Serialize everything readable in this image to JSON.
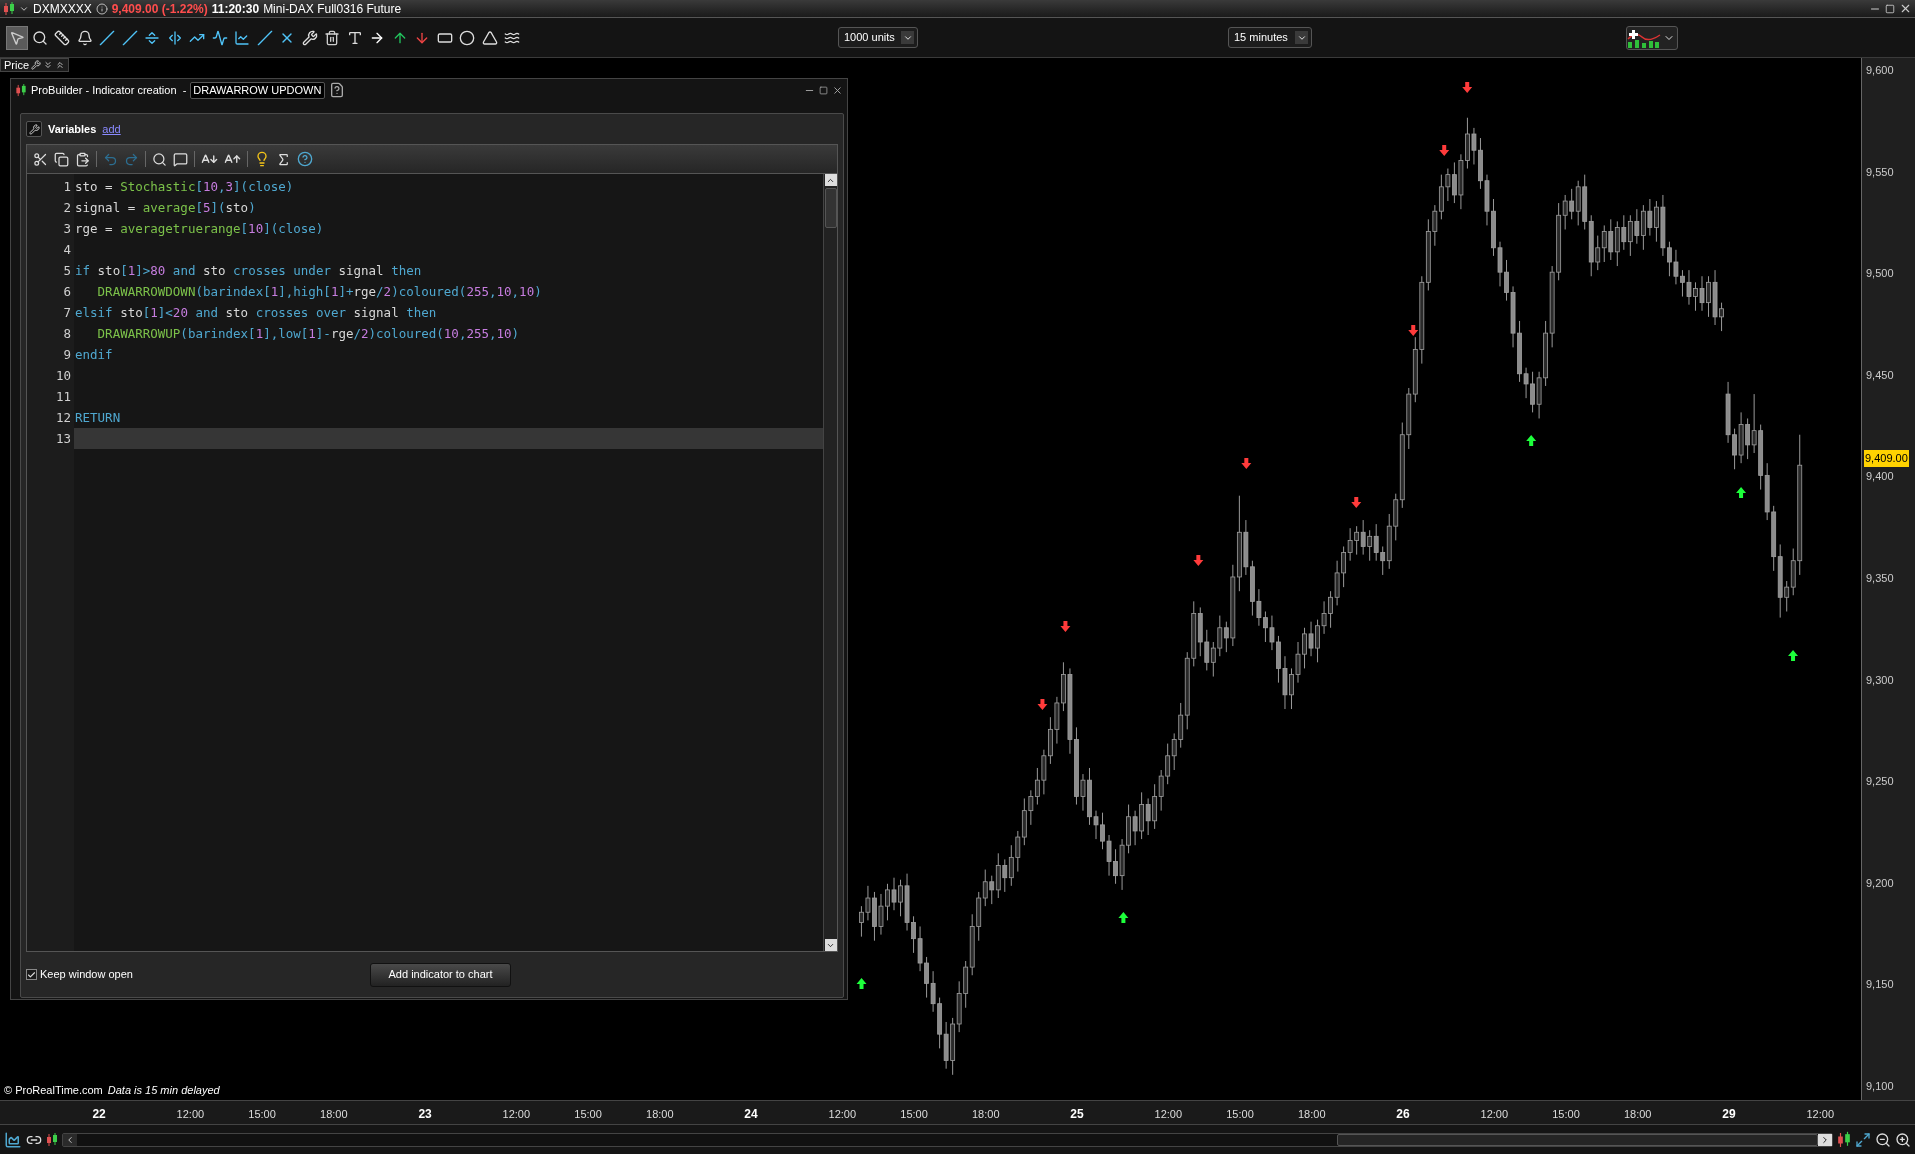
{
  "title_bar": {
    "symbol": "DXMXXXX",
    "price": "9,409.00 (-1.22%)",
    "time": "11:20:30",
    "instrument": "Mini-DAX Full0316 Future"
  },
  "toolbar": {
    "tools": [
      {
        "kind": "pointer",
        "selected": true
      },
      {
        "kind": "zoom",
        "selected": false
      },
      {
        "kind": "ruler",
        "selected": false
      },
      {
        "kind": "alert",
        "selected": false
      },
      {
        "kind": "segment",
        "selected": false
      },
      {
        "kind": "ray",
        "selected": false
      },
      {
        "kind": "hline",
        "selected": false
      },
      {
        "kind": "vline",
        "selected": false
      },
      {
        "kind": "channel",
        "selected": false
      },
      {
        "kind": "trend",
        "selected": false
      },
      {
        "kind": "regression",
        "selected": false
      },
      {
        "kind": "diagonal",
        "selected": false
      },
      {
        "kind": "cross",
        "selected": false
      },
      {
        "kind": "tools",
        "selected": false
      },
      {
        "kind": "trash",
        "selected": false
      },
      {
        "kind": "text",
        "selected": false
      },
      {
        "kind": "arrow-right",
        "selected": false
      },
      {
        "kind": "arrow-up",
        "selected": false
      },
      {
        "kind": "arrow-down",
        "selected": false
      },
      {
        "kind": "rectangle",
        "selected": false
      },
      {
        "kind": "ellipse",
        "selected": false
      },
      {
        "kind": "triangle",
        "selected": false
      },
      {
        "kind": "fan",
        "selected": false
      }
    ],
    "units": "1000 units",
    "timeframe": "15 minutes"
  },
  "price_panel": {
    "label": "Price"
  },
  "editor": {
    "title": "ProBuilder - Indicator creation  -",
    "name_value": "DRAWARROW UPDOWN",
    "variables_label": "Variables",
    "add_link": "add",
    "lines": [
      {
        "number": "1",
        "current": false,
        "tokens": [
          {
            "kind": "plain",
            "t": "sto = "
          },
          {
            "kind": "func",
            "t": "Stochastic"
          },
          {
            "kind": "kw",
            "t": "["
          },
          {
            "kind": "num",
            "t": "10"
          },
          {
            "kind": "kw",
            "t": ","
          },
          {
            "kind": "num",
            "t": "3"
          },
          {
            "kind": "kw",
            "t": "](close)"
          }
        ]
      },
      {
        "number": "2",
        "current": false,
        "tokens": [
          {
            "kind": "plain",
            "t": "signal = "
          },
          {
            "kind": "func",
            "t": "average"
          },
          {
            "kind": "kw",
            "t": "["
          },
          {
            "kind": "num",
            "t": "5"
          },
          {
            "kind": "kw",
            "t": "]("
          },
          {
            "kind": "plain",
            "t": "sto"
          },
          {
            "kind": "kw",
            "t": ")"
          }
        ]
      },
      {
        "number": "3",
        "current": false,
        "tokens": [
          {
            "kind": "plain",
            "t": "rge = "
          },
          {
            "kind": "func",
            "t": "averagetruerange"
          },
          {
            "kind": "kw",
            "t": "["
          },
          {
            "kind": "num",
            "t": "10"
          },
          {
            "kind": "kw",
            "t": "](close)"
          }
        ]
      },
      {
        "number": "4",
        "current": false
      },
      {
        "number": "5",
        "current": false,
        "tokens": [
          {
            "kind": "kw",
            "t": "if "
          },
          {
            "kind": "plain",
            "t": "sto"
          },
          {
            "kind": "kw",
            "t": "["
          },
          {
            "kind": "num",
            "t": "1"
          },
          {
            "kind": "kw",
            "t": "]>"
          },
          {
            "kind": "num",
            "t": "80"
          },
          {
            "kind": "kw",
            "t": " and "
          },
          {
            "kind": "plain",
            "t": "sto "
          },
          {
            "kind": "kw",
            "t": "crosses under "
          },
          {
            "kind": "plain",
            "t": "signal "
          },
          {
            "kind": "kw",
            "t": "then"
          }
        ]
      },
      {
        "number": "6",
        "current": false,
        "tokens": [
          {
            "kind": "func",
            "t": "   DRAWARROWDOWN"
          },
          {
            "kind": "kw",
            "t": "(barindex["
          },
          {
            "kind": "num",
            "t": "1"
          },
          {
            "kind": "kw",
            "t": "],high["
          },
          {
            "kind": "num",
            "t": "1"
          },
          {
            "kind": "kw",
            "t": "]+"
          },
          {
            "kind": "plain",
            "t": "rge"
          },
          {
            "kind": "kw",
            "t": "/"
          },
          {
            "kind": "num",
            "t": "2"
          },
          {
            "kind": "kw",
            "t": ")coloured("
          },
          {
            "kind": "num",
            "t": "255"
          },
          {
            "kind": "kw",
            "t": ","
          },
          {
            "kind": "num",
            "t": "10"
          },
          {
            "kind": "kw",
            "t": ","
          },
          {
            "kind": "num",
            "t": "10"
          },
          {
            "kind": "kw",
            "t": ")"
          }
        ]
      },
      {
        "number": "7",
        "current": false,
        "tokens": [
          {
            "kind": "kw",
            "t": "elsif "
          },
          {
            "kind": "plain",
            "t": "sto"
          },
          {
            "kind": "kw",
            "t": "["
          },
          {
            "kind": "num",
            "t": "1"
          },
          {
            "kind": "kw",
            "t": "]<"
          },
          {
            "kind": "num",
            "t": "20"
          },
          {
            "kind": "kw",
            "t": " and "
          },
          {
            "kind": "plain",
            "t": "sto "
          },
          {
            "kind": "kw",
            "t": "crosses over "
          },
          {
            "kind": "plain",
            "t": "signal "
          },
          {
            "kind": "kw",
            "t": "then"
          }
        ]
      },
      {
        "number": "8",
        "current": false,
        "tokens": [
          {
            "kind": "func",
            "t": "   DRAWARROWUP"
          },
          {
            "kind": "kw",
            "t": "(barindex["
          },
          {
            "kind": "num",
            "t": "1"
          },
          {
            "kind": "kw",
            "t": "],low["
          },
          {
            "kind": "num",
            "t": "1"
          },
          {
            "kind": "kw",
            "t": "]-"
          },
          {
            "kind": "plain",
            "t": "rge"
          },
          {
            "kind": "kw",
            "t": "/"
          },
          {
            "kind": "num",
            "t": "2"
          },
          {
            "kind": "kw",
            "t": ")coloured("
          },
          {
            "kind": "num",
            "t": "10"
          },
          {
            "kind": "kw",
            "t": ","
          },
          {
            "kind": "num",
            "t": "255"
          },
          {
            "kind": "kw",
            "t": ","
          },
          {
            "kind": "num",
            "t": "10"
          },
          {
            "kind": "kw",
            "t": ")"
          }
        ]
      },
      {
        "number": "9",
        "current": false,
        "tokens": [
          {
            "kind": "kw",
            "t": "endif"
          }
        ]
      },
      {
        "number": "10",
        "current": false
      },
      {
        "number": "11",
        "current": false
      },
      {
        "number": "12",
        "current": false,
        "tokens": [
          {
            "kind": "kw",
            "t": "RETURN"
          }
        ]
      },
      {
        "number": "13",
        "current": true
      }
    ],
    "keep_open": {
      "label": "Keep window open",
      "checked": true
    },
    "add_button": "Add indicator to chart"
  },
  "chart_footer": {
    "copyright": "© ProRealTime.com",
    "delay_note": "Data is 15 min delayed"
  },
  "price_tag": "9,409.00",
  "chart_data": {
    "type": "candlestick",
    "ylim": [
      9092.6,
      9605.4
    ],
    "yticks": [
      {
        "value": 9600,
        "label": "9,600"
      },
      {
        "value": 9550,
        "label": "9,550"
      },
      {
        "value": 9500,
        "label": "9,500"
      },
      {
        "value": 9450,
        "label": "9,450"
      },
      {
        "value": 9400,
        "label": "9,400"
      },
      {
        "value": 9350,
        "label": "9,350"
      },
      {
        "value": 9300,
        "label": "9,300"
      },
      {
        "value": 9250,
        "label": "9,250"
      },
      {
        "value": 9200,
        "label": "9,200"
      },
      {
        "value": 9150,
        "label": "9,150"
      },
      {
        "value": 9100,
        "label": "9,100"
      }
    ],
    "categories": [
      "22",
      null,
      null,
      null,
      null,
      null,
      null,
      null,
      null,
      null,
      null,
      null,
      null,
      null,
      "12:00",
      null,
      null,
      null,
      null,
      null,
      null,
      null,
      null,
      null,
      null,
      "15:00",
      null,
      null,
      null,
      null,
      null,
      null,
      null,
      null,
      null,
      null,
      "18:00",
      null,
      null,
      null,
      null,
      null,
      null,
      null,
      null,
      null,
      null,
      null,
      null,
      null,
      "23",
      null,
      null,
      null,
      null,
      null,
      null,
      null,
      null,
      null,
      null,
      null,
      null,
      null,
      "12:00",
      null,
      null,
      null,
      null,
      null,
      null,
      null,
      null,
      null,
      null,
      "15:00",
      null,
      null,
      null,
      null,
      null,
      null,
      null,
      null,
      null,
      null,
      "18:00",
      null,
      null,
      null,
      null,
      null,
      null,
      null,
      null,
      null,
      null,
      null,
      null,
      null,
      "24",
      null,
      null,
      null,
      null,
      null,
      null,
      null,
      null,
      null,
      null,
      null,
      null,
      null,
      "12:00",
      null,
      null,
      null,
      null,
      null,
      null,
      null,
      null,
      null,
      null,
      "15:00",
      null,
      null,
      null,
      null,
      null,
      null,
      null,
      null,
      null,
      null,
      "18:00",
      null,
      null,
      null,
      null,
      null,
      null,
      null,
      null,
      null,
      null,
      null,
      null,
      null,
      "25",
      null,
      null,
      null,
      null,
      null,
      null,
      null,
      null,
      null,
      null,
      null,
      null,
      null,
      "12:00",
      null,
      null,
      null,
      null,
      null,
      null,
      null,
      null,
      null,
      null,
      "15:00",
      null,
      null,
      null,
      null,
      null,
      null,
      null,
      null,
      null,
      null,
      "18:00",
      null,
      null,
      null,
      null,
      null,
      null,
      null,
      null,
      null,
      null,
      null,
      null,
      null,
      "26",
      null,
      null,
      null,
      null,
      null,
      null,
      null,
      null,
      null,
      null,
      null,
      null,
      null,
      "12:00",
      null,
      null,
      null,
      null,
      null,
      null,
      null,
      null,
      null,
      null,
      "15:00",
      null,
      null,
      null,
      null,
      null,
      null,
      null,
      null,
      null,
      null,
      "18:00",
      null,
      null,
      null,
      null,
      null,
      null,
      null,
      null,
      null,
      null,
      null,
      null,
      null,
      "29",
      null,
      null,
      null,
      null,
      null,
      null,
      null,
      null,
      null,
      null,
      null,
      null,
      null,
      "12:00"
    ],
    "ohlc": [
      null,
      null,
      null,
      null,
      null,
      null,
      null,
      null,
      null,
      null,
      null,
      null,
      null,
      null,
      null,
      null,
      null,
      null,
      null,
      null,
      null,
      null,
      null,
      null,
      null,
      null,
      null,
      null,
      null,
      null,
      null,
      null,
      null,
      null,
      null,
      null,
      null,
      null,
      null,
      null,
      null,
      null,
      null,
      null,
      null,
      null,
      null,
      null,
      null,
      null,
      null,
      null,
      null,
      null,
      null,
      null,
      null,
      null,
      null,
      null,
      null,
      null,
      null,
      null,
      null,
      null,
      null,
      null,
      null,
      null,
      null,
      null,
      null,
      null,
      null,
      null,
      null,
      null,
      null,
      null,
      null,
      null,
      null,
      null,
      null,
      null,
      null,
      null,
      null,
      null,
      null,
      null,
      null,
      null,
      null,
      null,
      null,
      null,
      null,
      null,
      null,
      null,
      null,
      null,
      null,
      null,
      null,
      null,
      null,
      null,
      null,
      null,
      null,
      null,
      null,
      null,
      null,
      [
        9180,
        9188,
        9173,
        9185
      ],
      [
        9185,
        9198,
        9181,
        9192
      ],
      [
        9192,
        9195,
        9171,
        9178
      ],
      [
        9178,
        9194,
        9174,
        9188
      ],
      [
        9188,
        9199,
        9181,
        9196
      ],
      [
        9196,
        9202,
        9186,
        9190
      ],
      [
        9190,
        9201,
        9183,
        9198
      ],
      [
        9198,
        9204,
        9176,
        9180
      ],
      [
        9180,
        9183,
        9165,
        9172
      ],
      [
        9172,
        9178,
        9156,
        9160
      ],
      [
        9160,
        9163,
        9143,
        9150
      ],
      [
        9150,
        9156,
        9136,
        9140
      ],
      [
        9140,
        9143,
        9118,
        9125
      ],
      [
        9125,
        9131,
        9108,
        9112
      ],
      [
        9112,
        9133,
        9105,
        9130
      ],
      [
        9130,
        9151,
        9126,
        9145
      ],
      [
        9145,
        9161,
        9138,
        9158
      ],
      [
        9158,
        9184,
        9154,
        9178
      ],
      [
        9178,
        9195,
        9171,
        9192
      ],
      [
        9192,
        9206,
        9188,
        9200
      ],
      [
        9200,
        9203,
        9189,
        9196
      ],
      [
        9196,
        9214,
        9192,
        9208
      ],
      [
        9208,
        9211,
        9195,
        9202
      ],
      [
        9202,
        9218,
        9198,
        9212
      ],
      [
        9212,
        9225,
        9205,
        9222
      ],
      [
        9222,
        9241,
        9218,
        9235
      ],
      [
        9235,
        9245,
        9228,
        9242
      ],
      [
        9242,
        9256,
        9238,
        9250
      ],
      [
        9250,
        9265,
        9243,
        9262
      ],
      [
        9262,
        9281,
        9258,
        9275
      ],
      [
        9275,
        9291,
        9268,
        9288
      ],
      [
        9288,
        9308,
        9284,
        9302
      ],
      [
        9302,
        9305,
        9263,
        9270
      ],
      [
        9270,
        9276,
        9238,
        9242
      ],
      [
        9242,
        9253,
        9235,
        9250
      ],
      [
        9250,
        9256,
        9228,
        9232
      ],
      [
        9232,
        9235,
        9221,
        9228
      ],
      [
        9228,
        9234,
        9216,
        9220
      ],
      [
        9220,
        9223,
        9203,
        9210
      ],
      [
        9210,
        9216,
        9199,
        9203
      ],
      [
        9203,
        9221,
        9196,
        9218
      ],
      [
        9218,
        9238,
        9214,
        9232
      ],
      [
        9232,
        9235,
        9218,
        9225
      ],
      [
        9225,
        9244,
        9221,
        9238
      ],
      [
        9238,
        9241,
        9223,
        9230
      ],
      [
        9230,
        9248,
        9226,
        9242
      ],
      [
        9242,
        9255,
        9235,
        9252
      ],
      [
        9252,
        9268,
        9248,
        9262
      ],
      [
        9262,
        9273,
        9255,
        9270
      ],
      [
        9270,
        9288,
        9266,
        9282
      ],
      [
        9282,
        9313,
        9275,
        9310
      ],
      [
        9310,
        9338,
        9306,
        9332
      ],
      [
        9332,
        9335,
        9311,
        9318
      ],
      [
        9318,
        9324,
        9304,
        9308
      ],
      [
        9308,
        9318,
        9301,
        9315
      ],
      [
        9315,
        9331,
        9311,
        9325
      ],
      [
        9325,
        9328,
        9313,
        9320
      ],
      [
        9320,
        9356,
        9316,
        9350
      ],
      [
        9350,
        9390,
        9343,
        9372
      ],
      [
        9372,
        9378,
        9351,
        9355
      ],
      [
        9355,
        9358,
        9331,
        9338
      ],
      [
        9338,
        9344,
        9326,
        9330
      ],
      [
        9330,
        9333,
        9318,
        9325
      ],
      [
        9325,
        9331,
        9314,
        9318
      ],
      [
        9318,
        9321,
        9298,
        9305
      ],
      [
        9305,
        9311,
        9285,
        9292
      ],
      [
        9292,
        9305,
        9285,
        9302
      ],
      [
        9302,
        9318,
        9298,
        9312
      ],
      [
        9312,
        9325,
        9305,
        9322
      ],
      [
        9322,
        9328,
        9311,
        9315
      ],
      [
        9315,
        9329,
        9308,
        9326
      ],
      [
        9326,
        9338,
        9322,
        9332
      ],
      [
        9332,
        9343,
        9325,
        9340
      ],
      [
        9340,
        9358,
        9336,
        9352
      ],
      [
        9352,
        9365,
        9345,
        9362
      ],
      [
        9362,
        9374,
        9358,
        9368
      ],
      [
        9368,
        9375,
        9361,
        9372
      ],
      [
        9372,
        9378,
        9361,
        9365
      ],
      [
        9365,
        9373,
        9358,
        9370
      ],
      [
        9370,
        9376,
        9358,
        9362
      ],
      [
        9362,
        9365,
        9351,
        9358
      ],
      [
        9358,
        9381,
        9354,
        9375
      ],
      [
        9375,
        9391,
        9368,
        9388
      ],
      [
        9388,
        9426,
        9384,
        9420
      ],
      [
        9420,
        9443,
        9413,
        9440
      ],
      [
        9440,
        9468,
        9436,
        9462
      ],
      [
        9462,
        9498,
        9455,
        9495
      ],
      [
        9495,
        9526,
        9491,
        9520
      ],
      [
        9520,
        9533,
        9513,
        9530
      ],
      [
        9530,
        9548,
        9526,
        9542
      ],
      [
        9542,
        9551,
        9535,
        9548
      ],
      [
        9548,
        9554,
        9534,
        9538
      ],
      [
        9538,
        9558,
        9531,
        9555
      ],
      [
        9555,
        9576,
        9551,
        9568
      ],
      [
        9568,
        9571,
        9553,
        9560
      ],
      [
        9560,
        9566,
        9541,
        9545
      ],
      [
        9545,
        9548,
        9523,
        9530
      ],
      [
        9530,
        9536,
        9508,
        9512
      ],
      [
        9512,
        9515,
        9493,
        9500
      ],
      [
        9500,
        9506,
        9486,
        9490
      ],
      [
        9490,
        9493,
        9463,
        9470
      ],
      [
        9470,
        9476,
        9446,
        9450
      ],
      [
        9450,
        9453,
        9438,
        9445
      ],
      [
        9445,
        9451,
        9431,
        9435
      ],
      [
        9435,
        9451,
        9428,
        9448
      ],
      [
        9448,
        9476,
        9444,
        9470
      ],
      [
        9470,
        9503,
        9463,
        9500
      ],
      [
        9500,
        9534,
        9496,
        9528
      ],
      [
        9528,
        9538,
        9521,
        9535
      ],
      [
        9535,
        9541,
        9526,
        9530
      ],
      [
        9530,
        9545,
        9523,
        9542
      ],
      [
        9542,
        9548,
        9521,
        9525
      ],
      [
        9525,
        9528,
        9498,
        9505
      ],
      [
        9505,
        9518,
        9501,
        9512
      ],
      [
        9512,
        9523,
        9505,
        9520
      ],
      [
        9520,
        9526,
        9506,
        9510
      ],
      [
        9510,
        9525,
        9503,
        9522
      ],
      [
        9522,
        9528,
        9511,
        9515
      ],
      [
        9515,
        9528,
        9508,
        9525
      ],
      [
        9525,
        9531,
        9514,
        9518
      ],
      [
        9518,
        9533,
        9511,
        9530
      ],
      [
        9530,
        9536,
        9518,
        9522
      ],
      [
        9522,
        9535,
        9515,
        9532
      ],
      [
        9532,
        9538,
        9508,
        9512
      ],
      [
        9512,
        9515,
        9498,
        9505
      ],
      [
        9505,
        9511,
        9494,
        9498
      ],
      [
        9498,
        9501,
        9488,
        9495
      ],
      [
        9495,
        9501,
        9484,
        9488
      ],
      [
        9488,
        9495,
        9481,
        9492
      ],
      [
        9492,
        9498,
        9481,
        9485
      ],
      [
        9485,
        9498,
        9478,
        9495
      ],
      [
        9495,
        9501,
        9474,
        9478
      ],
      [
        9478,
        9485,
        9471,
        9482
      ],
      [
        9440,
        9446,
        9416,
        9420
      ],
      [
        9420,
        9423,
        9403,
        9410
      ],
      [
        9410,
        9431,
        9406,
        9425
      ],
      [
        9425,
        9428,
        9408,
        9415
      ],
      [
        9415,
        9440,
        9411,
        9422
      ],
      [
        9422,
        9425,
        9393,
        9400
      ],
      [
        9400,
        9406,
        9378,
        9382
      ],
      [
        9382,
        9385,
        9353,
        9360
      ],
      [
        9360,
        9366,
        9330,
        9340
      ],
      [
        9340,
        9348,
        9333,
        9345
      ],
      [
        9345,
        9364,
        9341,
        9358
      ],
      [
        9358,
        9420,
        9351,
        9405
      ],
      null,
      null,
      null
    ]
  }
}
